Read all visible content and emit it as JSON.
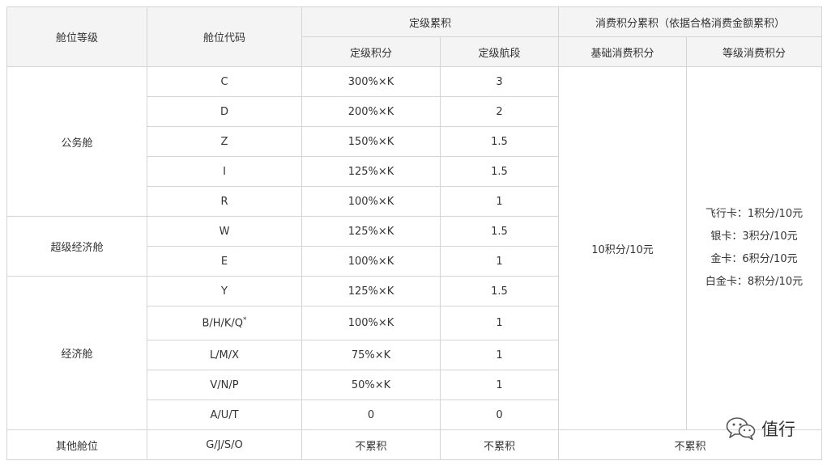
{
  "headers": {
    "cabin_class": "舱位等级",
    "booking_code": "舱位代码",
    "qualifying_accrual": "定级累积",
    "spending_accrual": "消费积分累积（依据合格消费金额累积）",
    "qualifying_points": "定级积分",
    "qualifying_segments": "定级航段",
    "base_spending_points": "基础消费积分",
    "tier_spending_points": "等级消费积分"
  },
  "groups": [
    {
      "name": "公务舱",
      "rows": [
        {
          "code": "C",
          "points": "300%×K",
          "segments": "3"
        },
        {
          "code": "D",
          "points": "200%×K",
          "segments": "2"
        },
        {
          "code": "Z",
          "points": "150%×K",
          "segments": "1.5"
        },
        {
          "code": "I",
          "points": "125%×K",
          "segments": "1.5"
        },
        {
          "code": "R",
          "points": "100%×K",
          "segments": "1"
        }
      ]
    },
    {
      "name": "超级经济舱",
      "rows": [
        {
          "code": "W",
          "points": "125%×K",
          "segments": "1.5"
        },
        {
          "code": "E",
          "points": "100%×K",
          "segments": "1"
        }
      ]
    },
    {
      "name": "经济舱",
      "rows": [
        {
          "code": "Y",
          "points": "125%×K",
          "segments": "1.5"
        },
        {
          "code": "B/H/K/Q",
          "code_mark": "*",
          "points": "100%×K",
          "segments": "1"
        },
        {
          "code": "L/M/X",
          "points": "75%×K",
          "segments": "1"
        },
        {
          "code": "V/N/P",
          "points": "50%×K",
          "segments": "1"
        },
        {
          "code": "A/U/T",
          "points": "0",
          "segments": "0"
        }
      ]
    }
  ],
  "base_spending_value": "10积分/10元",
  "tier_spending": [
    "飞行卡：1积分/10元",
    "银卡：3积分/10元",
    "金卡：6积分/10元",
    "白金卡：8积分/10元"
  ],
  "other_row": {
    "name": "其他舱位",
    "code": "G/J/S/O",
    "points": "不累积",
    "segments": "不累积",
    "spending": "不累积"
  },
  "watermark": {
    "text": "值行",
    "icon": "wechat-icon"
  }
}
